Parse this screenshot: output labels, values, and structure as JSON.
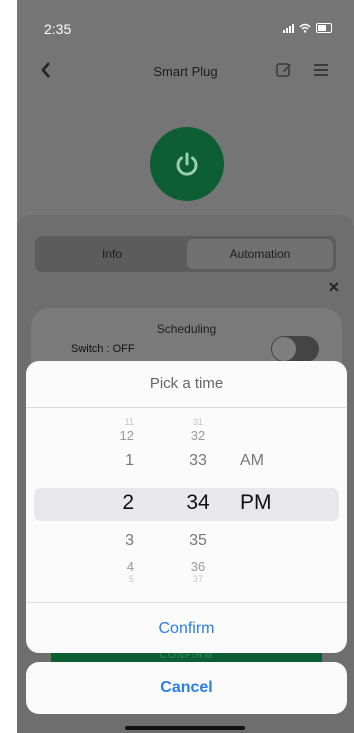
{
  "status": {
    "time": "2:35"
  },
  "nav": {
    "title": "Smart Plug"
  },
  "tabs": [
    {
      "label": "Info"
    },
    {
      "label": "Automation"
    }
  ],
  "schedule": {
    "title": "Scheduling",
    "switch_label": "Switch : OFF"
  },
  "picker": {
    "title": "Pick a time",
    "hours": [
      "11",
      "12",
      "1",
      "2",
      "3",
      "4",
      "5"
    ],
    "minutes": [
      "31",
      "32",
      "33",
      "34",
      "35",
      "36",
      "37"
    ],
    "ampm": [
      "AM",
      "PM"
    ],
    "selected": {
      "hour": "2",
      "minute": "34",
      "ampm": "PM"
    },
    "confirm_label": "Confirm"
  },
  "background_button": {
    "label": "CONFIRM"
  },
  "cancel_label": "Cancel",
  "colors": {
    "accent": "#2a7ee6",
    "power_button": "#0d5f33"
  },
  "icons": [
    "back-chevron-icon",
    "edit-icon",
    "menu-icon",
    "power-icon",
    "close-icon"
  ]
}
